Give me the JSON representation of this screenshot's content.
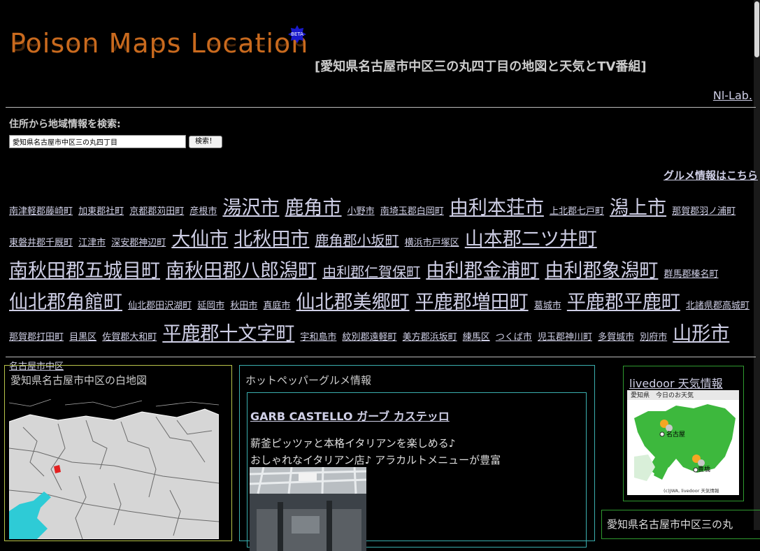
{
  "header": {
    "logo_text": "Poison Maps Location",
    "beta_badge": "BETA",
    "page_title": "[愛知県名古屋市中区三の丸四丁目の地図と天気とTV番組]",
    "nl_lab_link": "Nl-Lab."
  },
  "search": {
    "label": "住所から地域情報を検索:",
    "value": "愛知県名古屋市中区三の丸四丁目",
    "button_label": "検索！"
  },
  "gourmet_link": "グルメ情報はこちら",
  "tag_cloud": [
    {
      "t": "南津軽郡藤崎町",
      "s": "s"
    },
    {
      "t": "加東郡社町",
      "s": "s"
    },
    {
      "t": "京都郡苅田町",
      "s": "s"
    },
    {
      "t": "彦根市",
      "s": "s"
    },
    {
      "t": "湯沢市",
      "s": "l"
    },
    {
      "t": "鹿角市",
      "s": "l"
    },
    {
      "t": "小野市",
      "s": "s"
    },
    {
      "t": "南埼玉郡白岡町",
      "s": "s"
    },
    {
      "t": "由利本荘市",
      "s": "l"
    },
    {
      "t": "上北郡七戸町",
      "s": "s"
    },
    {
      "t": "潟上市",
      "s": "l"
    },
    {
      "t": "那賀郡羽ノ浦町",
      "s": "s"
    },
    {
      "t": "東磐井郡千厩町",
      "s": "s"
    },
    {
      "t": "江津市",
      "s": "s"
    },
    {
      "t": "深安郡神辺町",
      "s": "s"
    },
    {
      "t": "大仙市",
      "s": "l"
    },
    {
      "t": "北秋田市",
      "s": "l"
    },
    {
      "t": "鹿角郡小坂町",
      "s": "m"
    },
    {
      "t": "横浜市戸塚区",
      "s": "s"
    },
    {
      "t": "山本郡二ツ井町",
      "s": "l"
    },
    {
      "t": "南秋田郡五城目町",
      "s": "l"
    },
    {
      "t": "南秋田郡八郎潟町",
      "s": "l"
    },
    {
      "t": "由利郡仁賀保町",
      "s": "m"
    },
    {
      "t": "由利郡金浦町",
      "s": "l"
    },
    {
      "t": "由利郡象潟町",
      "s": "l"
    },
    {
      "t": "群馬郡榛名町",
      "s": "s"
    },
    {
      "t": "仙北郡角館町",
      "s": "l"
    },
    {
      "t": "仙北郡田沢湖町",
      "s": "s"
    },
    {
      "t": "延岡市",
      "s": "s"
    },
    {
      "t": "秋田市",
      "s": "s"
    },
    {
      "t": "真庭市",
      "s": "s"
    },
    {
      "t": "仙北郡美郷町",
      "s": "l"
    },
    {
      "t": "平鹿郡増田町",
      "s": "l"
    },
    {
      "t": "葛城市",
      "s": "s"
    },
    {
      "t": "平鹿郡平鹿町",
      "s": "l"
    },
    {
      "t": "北諸県郡高城町",
      "s": "s"
    },
    {
      "t": "那賀郡打田町",
      "s": "s"
    },
    {
      "t": "目黒区",
      "s": "s"
    },
    {
      "t": "佐賀郡大和町",
      "s": "s"
    },
    {
      "t": "平鹿郡十文字町",
      "s": "l"
    },
    {
      "t": "宇和島市",
      "s": "s"
    },
    {
      "t": "紋別郡遠軽町",
      "s": "s"
    },
    {
      "t": "美方郡浜坂町",
      "s": "s"
    },
    {
      "t": "練馬区",
      "s": "s"
    },
    {
      "t": "つくば市",
      "s": "s"
    },
    {
      "t": "児玉郡神川町",
      "s": "s"
    },
    {
      "t": "多賀城市",
      "s": "s"
    },
    {
      "t": "別府市",
      "s": "s"
    },
    {
      "t": "山形市",
      "s": "l"
    },
    {
      "t": "名古屋市中区",
      "s": "s"
    }
  ],
  "map_panel": {
    "title": "愛知県名古屋市中区の白地図"
  },
  "hotpepper": {
    "title": "ホットペッパーグルメ情報",
    "shop_name": "GARB CASTELLO ガーブ カステッロ",
    "desc_line1": "薪釜ピッツァと本格イタリアンを楽しめる♪",
    "desc_line2": "おしゃれなイタリアン店♪ アラカルトメニューが豊富"
  },
  "weather": {
    "title": "livedoor 天気情報",
    "map_header": "愛知県　今日のお天気",
    "city1": "名古屋",
    "city2": "豊橋",
    "credit": "(c)JWA, livedoor 天気情報"
  },
  "address_panel": {
    "title": "愛知県名古屋市中区三の丸"
  },
  "colors": {
    "background": "#000000",
    "logo": "#c96a1e",
    "link": "#cfcfe6",
    "map_accent": "#2ecbd6",
    "weather_land": "#3db83d"
  }
}
